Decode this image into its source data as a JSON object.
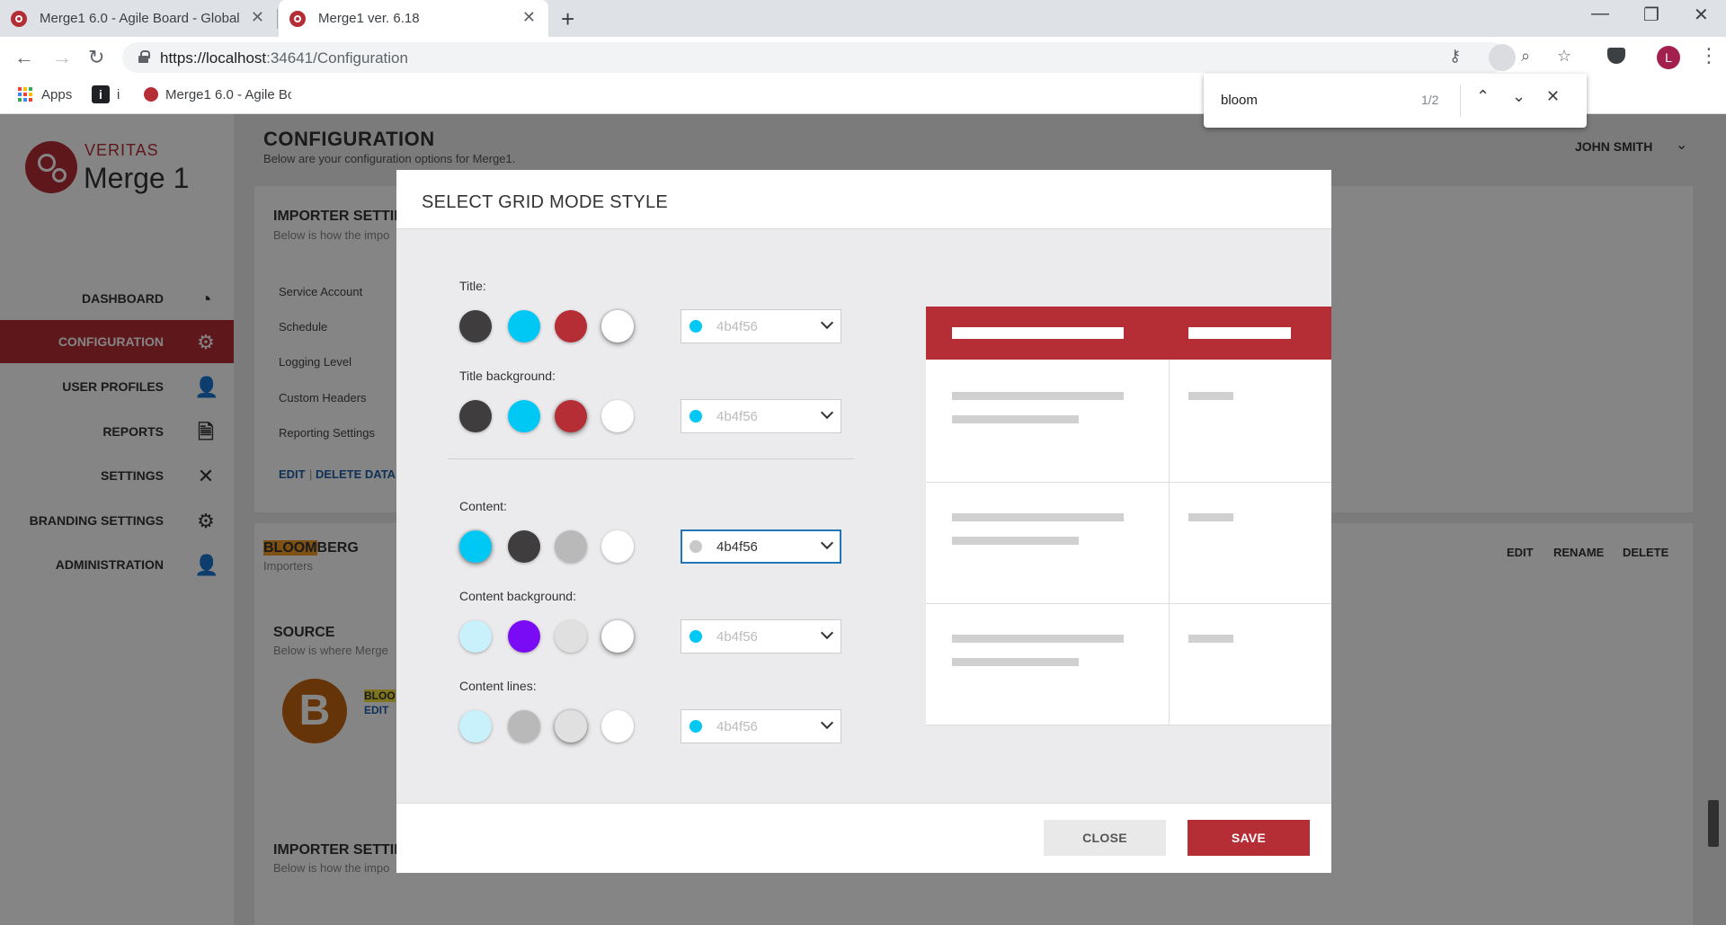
{
  "browser": {
    "tabs": [
      {
        "label": "Merge1 6.0 - Agile Board - Global"
      },
      {
        "label": "Merge1 ver. 6.18"
      }
    ],
    "new_tab_symbol": "+",
    "url_host": "https://localhost",
    "url_rest": ":34641/Configuration",
    "profile_initial": "L",
    "bookmarks": [
      {
        "label": "Apps"
      },
      {
        "label": "i"
      },
      {
        "label": "Merge1 6.0 - Agile Bo"
      }
    ]
  },
  "find_bar": {
    "query": "bloom",
    "count": "1/2"
  },
  "app": {
    "logo": {
      "brand": "VERITAS",
      "product": "Merge 1"
    },
    "nav": [
      {
        "label": "DASHBOARD",
        "icon": "dashboard-icon",
        "glyph": "◔"
      },
      {
        "label": "CONFIGURATION",
        "icon": "gear-icon",
        "glyph": "⚙",
        "active": true
      },
      {
        "label": "USER PROFILES",
        "icon": "user-icon",
        "glyph": "👤"
      },
      {
        "label": "REPORTS",
        "icon": "document-icon",
        "glyph": "🗎"
      },
      {
        "label": "SETTINGS",
        "icon": "tools-icon",
        "glyph": "✕"
      },
      {
        "label": "BRANDING SETTINGS",
        "icon": "gears-icon",
        "glyph": "⚙"
      },
      {
        "label": "ADMINISTRATION",
        "icon": "admin-user-icon",
        "glyph": "👤"
      }
    ],
    "page_title": "CONFIGURATION",
    "page_subtitle": "Below are your configuration options for Merge1.",
    "user": "JOHN SMITH",
    "importer_settings": {
      "title": "IMPORTER SETTIN",
      "subtitle": "Below is how the impo",
      "rows": [
        "Service Account",
        "Schedule",
        "Logging Level",
        "Custom Headers",
        "Reporting Settings"
      ],
      "edit": "EDIT",
      "sep": "|",
      "delete_data": "DELETE DATA"
    },
    "importer": {
      "name_hl": "BLOOM",
      "name_rest": "BERG",
      "type": "Importers",
      "actions": [
        "EDIT",
        "RENAME",
        "DELETE"
      ]
    },
    "source": {
      "title": "SOURCE",
      "subtitle": "Below is where Merge",
      "avatar": "B",
      "name_hl": "BLOO",
      "edit": "EDIT"
    },
    "importer_settings_2": {
      "title": "IMPORTER SETTIN",
      "subtitle": "Below is how the impo"
    }
  },
  "modal": {
    "title": "SELECT GRID MODE STYLE",
    "sections": [
      {
        "label": "Title:",
        "swatches": [
          "#3f3d3e",
          "#00c8f5",
          "#b52d35",
          "#ffffff"
        ],
        "selected": 3,
        "select_dot": "#00c8f5",
        "select_value": "4b4f56"
      },
      {
        "label": "Title background:",
        "swatches": [
          "#3f3d3e",
          "#00c8f5",
          "#b52d35",
          "#ffffff"
        ],
        "selected": 2,
        "select_dot": "#00c8f5",
        "select_value": "4b4f56"
      },
      {
        "label": "Content:",
        "swatches": [
          "#00c8f5",
          "#3f3d3e",
          "#b9b9b9",
          "#ffffff"
        ],
        "selected": 0,
        "select_dot": "#c8c8c8",
        "select_value": "4b4f56",
        "focused": true
      },
      {
        "label": "Content background:",
        "swatches": [
          "#c9f1fb",
          "#7a0cf5",
          "#e0e0e0",
          "#ffffff"
        ],
        "selected": 3,
        "select_dot": "#00c8f5",
        "select_value": "4b4f56"
      },
      {
        "label": "Content lines:",
        "swatches": [
          "#c9f1fb",
          "#b9b9b9",
          "#e0e0e0",
          "#ffffff"
        ],
        "selected": 2,
        "select_dot": "#00c8f5",
        "select_value": "4b4f56"
      }
    ],
    "preview": {
      "header_color": "#b52d35",
      "rows": 3
    },
    "close_label": "CLOSE",
    "save_label": "SAVE"
  },
  "colors": {
    "brand_red": "#b52d35",
    "find_highlight_active": "#f29a28",
    "find_highlight": "#f2e13a",
    "link_blue": "#1f5fa8"
  }
}
